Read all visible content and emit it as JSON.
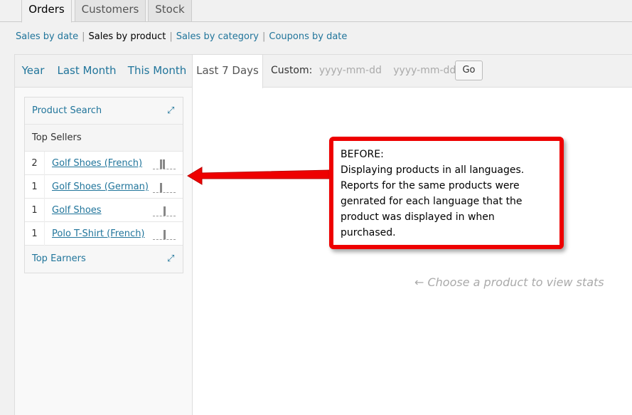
{
  "tabs": [
    "Orders",
    "Customers",
    "Stock"
  ],
  "sub_links": {
    "sales_by_date": "Sales by date",
    "sales_by_product": "Sales by product",
    "sales_by_category": "Sales by category",
    "coupons_by_date": "Coupons by date",
    "separator": "|"
  },
  "ranges": [
    "Year",
    "Last Month",
    "This Month",
    "Last 7 Days"
  ],
  "custom": {
    "label": "Custom:",
    "from_placeholder": "yyyy-mm-dd",
    "to_placeholder": "yyyy-mm-dd",
    "go_label": "Go"
  },
  "sidebar": {
    "product_search": "Product Search",
    "top_sellers": "Top Sellers",
    "top_earners": "Top Earners",
    "sellers": [
      {
        "count": "2",
        "name": "Golf Shoes (French)"
      },
      {
        "count": "1",
        "name": "Golf Shoes (German)"
      },
      {
        "count": "1",
        "name": "Golf Shoes"
      },
      {
        "count": "1",
        "name": "Polo T-Shirt (French)"
      }
    ]
  },
  "main": {
    "empty_message": "← Choose a product to view stats"
  },
  "callout": {
    "line1": "BEFORE:",
    "line2": "Displaying products in all languages.",
    "line3": "Reports for the same products were genrated for each language that the product was displayed in when purchased."
  }
}
